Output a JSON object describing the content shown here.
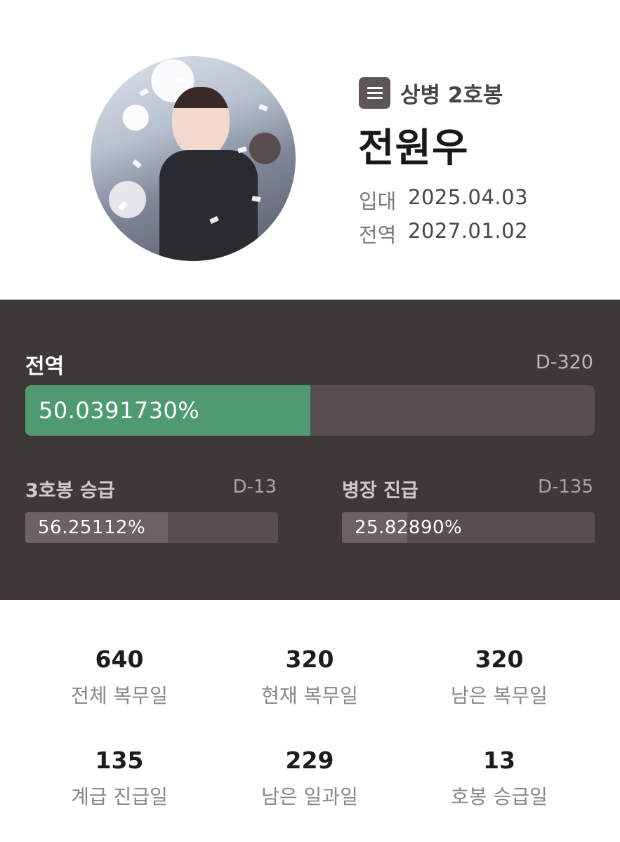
{
  "profile": {
    "rank": "상병 2호봉",
    "name": "전원우",
    "enlist_label": "입대",
    "enlist_date": "2025.04.03",
    "discharge_label": "전역",
    "discharge_date": "2027.01.02"
  },
  "progress": {
    "main": {
      "label": "전역",
      "dday": "D-320",
      "percent_text": "50.0391730%",
      "fraction": 0.50039173,
      "fill_color": "#4f9a70"
    },
    "sub": [
      {
        "label": "3호봉 승급",
        "dday": "D-13",
        "percent_text": "56.25112%",
        "fraction": 0.5625112
      },
      {
        "label": "병장 진급",
        "dday": "D-135",
        "percent_text": "25.82890%",
        "fraction": 0.258289
      }
    ]
  },
  "stats": [
    {
      "value": "640",
      "label": "전체 복무일"
    },
    {
      "value": "320",
      "label": "현재 복무일"
    },
    {
      "value": "320",
      "label": "남은 복무일"
    },
    {
      "value": "135",
      "label": "계급 진급일"
    },
    {
      "value": "229",
      "label": "남은 일과일"
    },
    {
      "value": "13",
      "label": "호봉 승급일"
    }
  ],
  "colors": {
    "panel_bg": "#3f3839",
    "accent_green": "#4f9a70",
    "rank_icon_bg": "#5e5556"
  },
  "icons": {
    "rank": "menu-lines-icon"
  }
}
